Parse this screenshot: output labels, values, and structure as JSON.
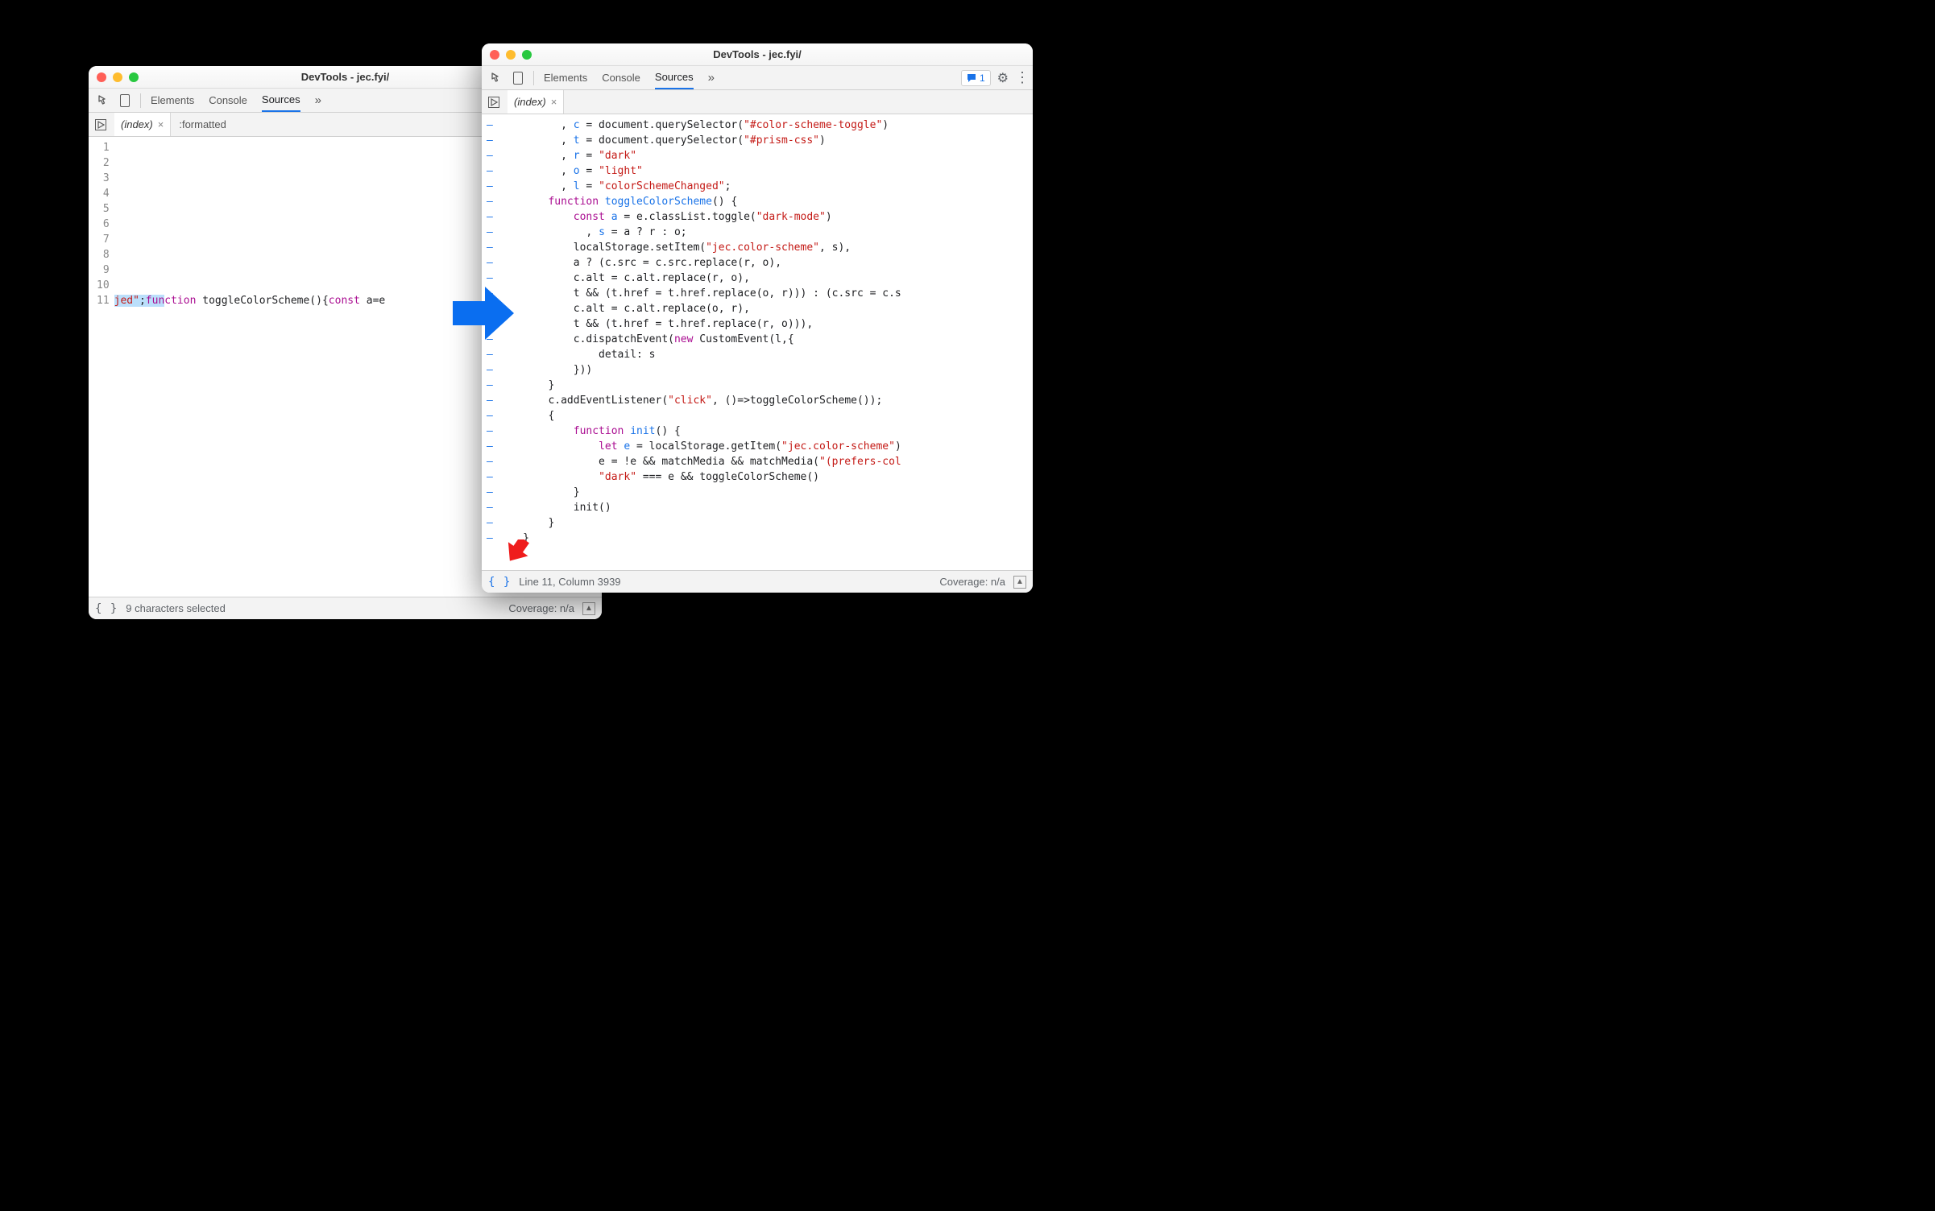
{
  "window1": {
    "title": "DevTools - jec.fyi/",
    "tabs": {
      "elements": "Elements",
      "console": "Console",
      "sources": "Sources",
      "more": "»"
    },
    "file_tab": "(index)",
    "ghost_tab": ":formatted",
    "line_numbers": [
      "1",
      "2",
      "3",
      "4",
      "5",
      "6",
      "7",
      "8",
      "9",
      "10",
      "11"
    ],
    "code_prefix_str": "jed\"",
    "code_semicolon": ";",
    "code_kw1": "function",
    "code_fn_name": " toggleColorScheme(){",
    "code_kw2": "const",
    "code_after": " a=e",
    "status_left": "9 characters selected",
    "coverage": "Coverage: n/a"
  },
  "window2": {
    "title": "DevTools - jec.fyi/",
    "tabs": {
      "elements": "Elements",
      "console": "Console",
      "sources": "Sources",
      "more": "»"
    },
    "issues_count": "1",
    "file_tab": "(index)",
    "dash": "–",
    "code_lines": [
      [
        {
          "t": "          , "
        },
        {
          "t": "c",
          "c": "id"
        },
        {
          "t": " = document.querySelector("
        },
        {
          "t": "\"#color-scheme-toggle\"",
          "c": "str"
        },
        {
          "t": ")"
        }
      ],
      [
        {
          "t": "          , "
        },
        {
          "t": "t",
          "c": "id"
        },
        {
          "t": " = document.querySelector("
        },
        {
          "t": "\"#prism-css\"",
          "c": "str"
        },
        {
          "t": ")"
        }
      ],
      [
        {
          "t": "          , "
        },
        {
          "t": "r",
          "c": "id"
        },
        {
          "t": " = "
        },
        {
          "t": "\"dark\"",
          "c": "str"
        }
      ],
      [
        {
          "t": "          , "
        },
        {
          "t": "o",
          "c": "id"
        },
        {
          "t": " = "
        },
        {
          "t": "\"light\"",
          "c": "str"
        }
      ],
      [
        {
          "t": "          , "
        },
        {
          "t": "l",
          "c": "id"
        },
        {
          "t": " = "
        },
        {
          "t": "\"colorSchemeChanged\"",
          "c": "str"
        },
        {
          "t": ";"
        }
      ],
      [
        {
          "t": "        "
        },
        {
          "t": "function",
          "c": "kw"
        },
        {
          "t": " "
        },
        {
          "t": "toggleColorScheme",
          "c": "id"
        },
        {
          "t": "() {"
        }
      ],
      [
        {
          "t": "            "
        },
        {
          "t": "const",
          "c": "kw"
        },
        {
          "t": " "
        },
        {
          "t": "a",
          "c": "id"
        },
        {
          "t": " = e.classList.toggle("
        },
        {
          "t": "\"dark-mode\"",
          "c": "str"
        },
        {
          "t": ")"
        }
      ],
      [
        {
          "t": "              , "
        },
        {
          "t": "s",
          "c": "id"
        },
        {
          "t": " = a ? r : o;"
        }
      ],
      [
        {
          "t": "            localStorage.setItem("
        },
        {
          "t": "\"jec.color-scheme\"",
          "c": "str"
        },
        {
          "t": ", s),"
        }
      ],
      [
        {
          "t": "            a ? (c.src = c.src.replace(r, o),"
        }
      ],
      [
        {
          "t": "            c.alt = c.alt.replace(r, o),"
        }
      ],
      [
        {
          "t": "            t && (t.href = t.href.replace(o, r))) : (c.src = c.s"
        }
      ],
      [
        {
          "t": "            c.alt = c.alt.replace(o, r),"
        }
      ],
      [
        {
          "t": "            t && (t.href = t.href.replace(r, o))),"
        }
      ],
      [
        {
          "t": "            c.dispatchEvent("
        },
        {
          "t": "new",
          "c": "kw"
        },
        {
          "t": " CustomEvent(l,{"
        }
      ],
      [
        {
          "t": "                detail: s"
        }
      ],
      [
        {
          "t": "            }))"
        }
      ],
      [
        {
          "t": "        }"
        }
      ],
      [
        {
          "t": "        c.addEventListener("
        },
        {
          "t": "\"click\"",
          "c": "str"
        },
        {
          "t": ", ()=>toggleColorScheme());"
        }
      ],
      [
        {
          "t": "        {"
        }
      ],
      [
        {
          "t": "            "
        },
        {
          "t": "function",
          "c": "kw"
        },
        {
          "t": " "
        },
        {
          "t": "init",
          "c": "id"
        },
        {
          "t": "() {"
        }
      ],
      [
        {
          "t": "                "
        },
        {
          "t": "let",
          "c": "kw"
        },
        {
          "t": " "
        },
        {
          "t": "e",
          "c": "id"
        },
        {
          "t": " = localStorage.getItem("
        },
        {
          "t": "\"jec.color-scheme\"",
          "c": "str"
        },
        {
          "t": ")"
        }
      ],
      [
        {
          "t": "                e = !e && matchMedia && matchMedia("
        },
        {
          "t": "\"(prefers-col",
          "c": "str"
        }
      ],
      [
        {
          "t": "                "
        },
        {
          "t": "\"dark\"",
          "c": "str"
        },
        {
          "t": " === e && toggleColorScheme()"
        }
      ],
      [
        {
          "t": "            }"
        }
      ],
      [
        {
          "t": "            init()"
        }
      ],
      [
        {
          "t": "        }"
        }
      ],
      [
        {
          "t": "    }"
        }
      ]
    ],
    "status_left": "Line 11, Column 3939",
    "coverage": "Coverage: n/a"
  }
}
